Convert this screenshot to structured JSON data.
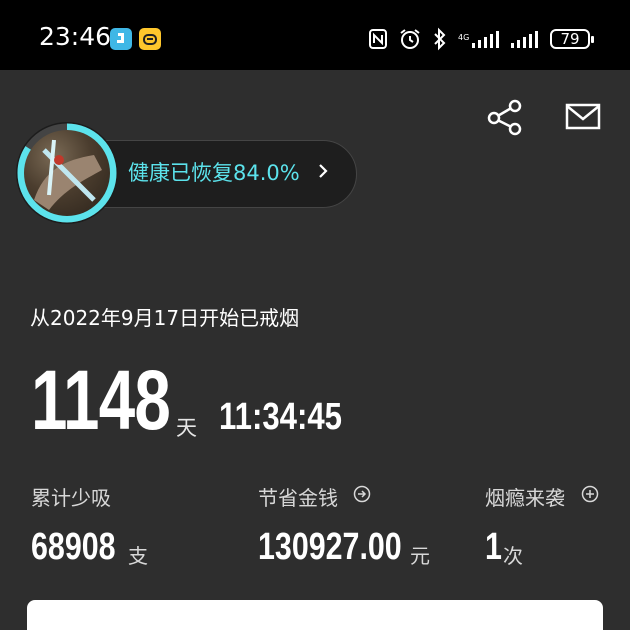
{
  "status_bar": {
    "time": "23:46",
    "battery": "79",
    "icons": [
      "nfc-icon",
      "alarm-icon",
      "bluetooth-icon",
      "signal-icon",
      "signal-icon",
      "battery-icon"
    ]
  },
  "header": {
    "share_icon": "share-icon",
    "mail_icon": "mail-icon"
  },
  "recovery": {
    "label": "健康已恢复84.0%",
    "progress_fraction": 0.84,
    "accent_color": "#5ce3ec"
  },
  "quit": {
    "since_text": "从2022年9月17日开始已戒烟",
    "days": "1148",
    "days_unit": "天",
    "elapsed_time": "11:34:45"
  },
  "stats": [
    {
      "label": "累计少吸",
      "value": "68908",
      "unit": "支",
      "icon": ""
    },
    {
      "label": "节省金钱",
      "value": "130927.00",
      "unit": "元",
      "icon": "arrow-right-circle-icon"
    },
    {
      "label": "烟瘾来袭",
      "value": "1",
      "unit": "次",
      "icon": "plus-circle-icon"
    }
  ]
}
